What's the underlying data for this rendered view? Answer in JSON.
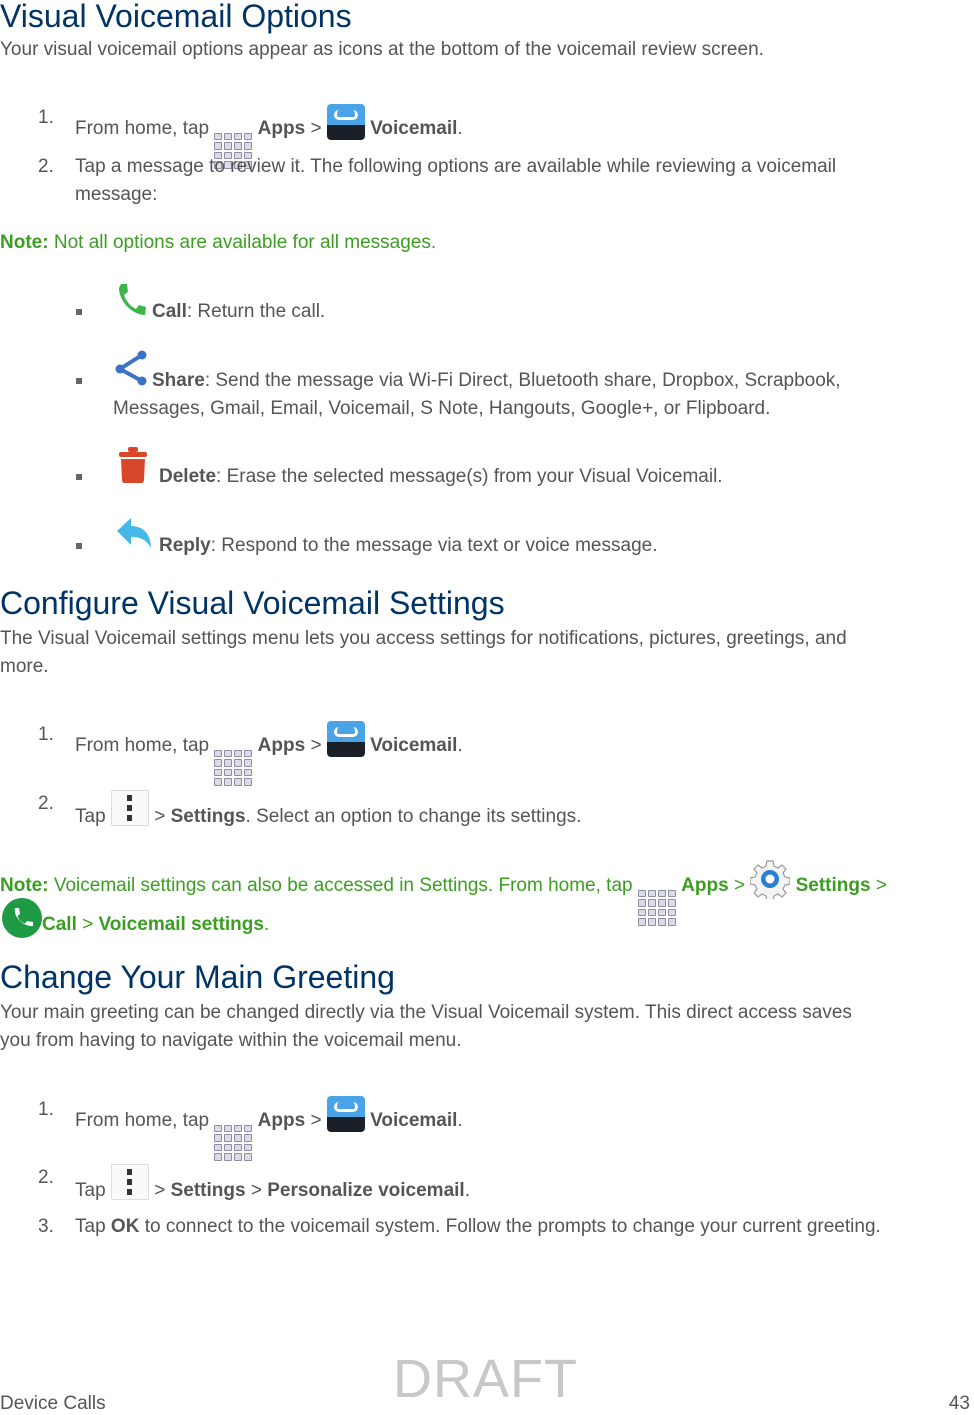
{
  "sections": [
    {
      "title": "Visual Voicemail Options",
      "intro": "Your visual voicemail options appear as icons at the bottom of the voicemail review screen.",
      "steps": [
        {
          "num": "1.",
          "pre": "From home, tap",
          "apps": "Apps",
          "sep": ">",
          "voicemail": "Voicemail",
          "end": "."
        },
        {
          "num": "2.",
          "line1": "Tap a message to review it. The following options are available while reviewing a voicemail",
          "line2": "message:"
        }
      ],
      "note": {
        "label": "Note:",
        "text": "Not all options are available for all messages."
      },
      "options": [
        {
          "icon": "phone-icon",
          "label": "Call",
          "desc": ": Return the call."
        },
        {
          "icon": "share-icon",
          "label": "Share",
          "desc": ": Send the message via Wi-Fi Direct, Bluetooth share, Dropbox, Scrapbook,",
          "desc2": "Messages, Gmail, Email, Voicemail, S Note, Hangouts, Google+, or Flipboard."
        },
        {
          "icon": "trash-icon",
          "label": "Delete",
          "desc": ": Erase the selected message(s) from your Visual Voicemail."
        },
        {
          "icon": "reply-icon",
          "label": "Reply",
          "desc": ": Respond to the message via text or voice message."
        }
      ]
    },
    {
      "title": "Configure Visual Voicemail Settings",
      "intro1": "The Visual Voicemail settings menu lets you access settings for notifications, pictures, greetings, and",
      "intro2": "more.",
      "steps": [
        {
          "num": "1.",
          "pre": "From home, tap",
          "apps": "Apps",
          "sep": ">",
          "voicemail": "Voicemail",
          "end": "."
        },
        {
          "num": "2.",
          "pre": "Tap",
          "sep": ">",
          "settings": "Settings",
          "rest": ". Select an option to change its settings."
        }
      ],
      "note": {
        "label": "Note:",
        "text": "Voicemail settings can also be accessed in Settings. From home, tap",
        "apps": "Apps",
        "sep": ">",
        "settings": "Settings",
        "call": "Call",
        "voicemail_settings": "Voicemail settings",
        "end": "."
      }
    },
    {
      "title": "Change Your Main Greeting",
      "intro1": "Your main greeting can be changed directly via the Visual Voicemail system. This direct access saves",
      "intro2": "you from having to navigate within the voicemail menu.",
      "steps": [
        {
          "num": "1.",
          "pre": "From home, tap",
          "apps": "Apps",
          "sep": ">",
          "voicemail": "Voicemail",
          "end": "."
        },
        {
          "num": "2.",
          "pre": "Tap",
          "sep": ">",
          "settings": "Settings",
          "personalize": "Personalize voicemail",
          "end": "."
        },
        {
          "num": "3.",
          "pre": "Tap",
          "ok": "OK",
          "rest": "to connect to the voicemail system. Follow the prompts to change your current greeting."
        }
      ]
    }
  ],
  "watermark": "DRAFT",
  "footer": {
    "chapter": "Device Calls",
    "page": "43"
  },
  "colors": {
    "heading": "#003366",
    "body": "#555555",
    "note": "#3b9e22"
  }
}
